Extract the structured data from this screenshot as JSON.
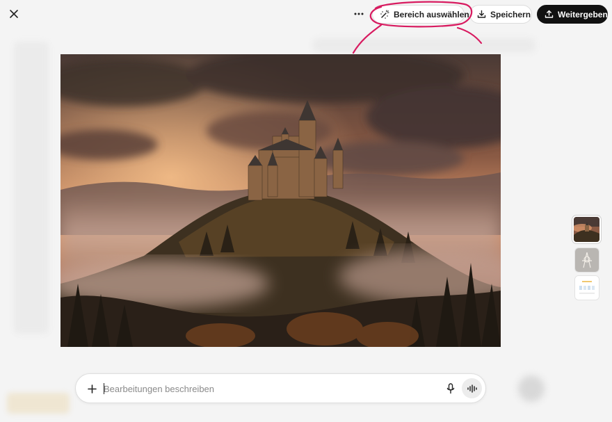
{
  "toolbar": {
    "more_icon": "more-horizontal-icon",
    "select_area_label": "Bereich auswählen",
    "save_label": "Speichern",
    "share_label": "Weitergeben"
  },
  "composer": {
    "placeholder": "Bearbeitungen beschreiben",
    "value": ""
  },
  "annotation": {
    "color": "#d81b60"
  },
  "colors": {
    "background": "#f4f4f4",
    "share_button_bg": "#111111"
  }
}
